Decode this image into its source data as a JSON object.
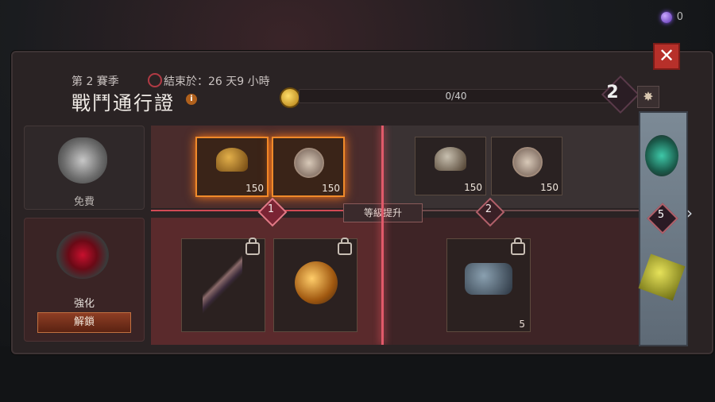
{
  "currency": {
    "amount": "0"
  },
  "header": {
    "season": "第 2 賽季",
    "timer": "結束於：26 天9 小時",
    "title": "戰鬥通行證",
    "info_glyph": "i",
    "xp": "0/40",
    "level": "2",
    "rank_glyph": "✸",
    "close_glyph": "✕"
  },
  "tracks": {
    "free_label": "免費",
    "premium_label": "強化",
    "unlock_label": "解鎖"
  },
  "free_rewards": [
    {
      "amount": "150",
      "icon": "helmet-icon",
      "active": true
    },
    {
      "amount": "150",
      "icon": "coin-icon",
      "active": true
    },
    {
      "amount": "150",
      "icon": "helmet-icon",
      "active": false
    },
    {
      "amount": "150",
      "icon": "coin-icon",
      "active": false
    }
  ],
  "nodes": [
    {
      "label": "1",
      "active": true
    },
    {
      "label": "2",
      "active": false
    }
  ],
  "level_up_label": "等級提升",
  "premium_rewards": [
    {
      "icon": "crossbow-icon",
      "locked": true
    },
    {
      "icon": "gold-orb-icon",
      "locked": true
    },
    {
      "icon": "scroll-icon",
      "locked": true,
      "amount": "5"
    }
  ],
  "banner": {
    "level": "5",
    "chevron": "›"
  }
}
